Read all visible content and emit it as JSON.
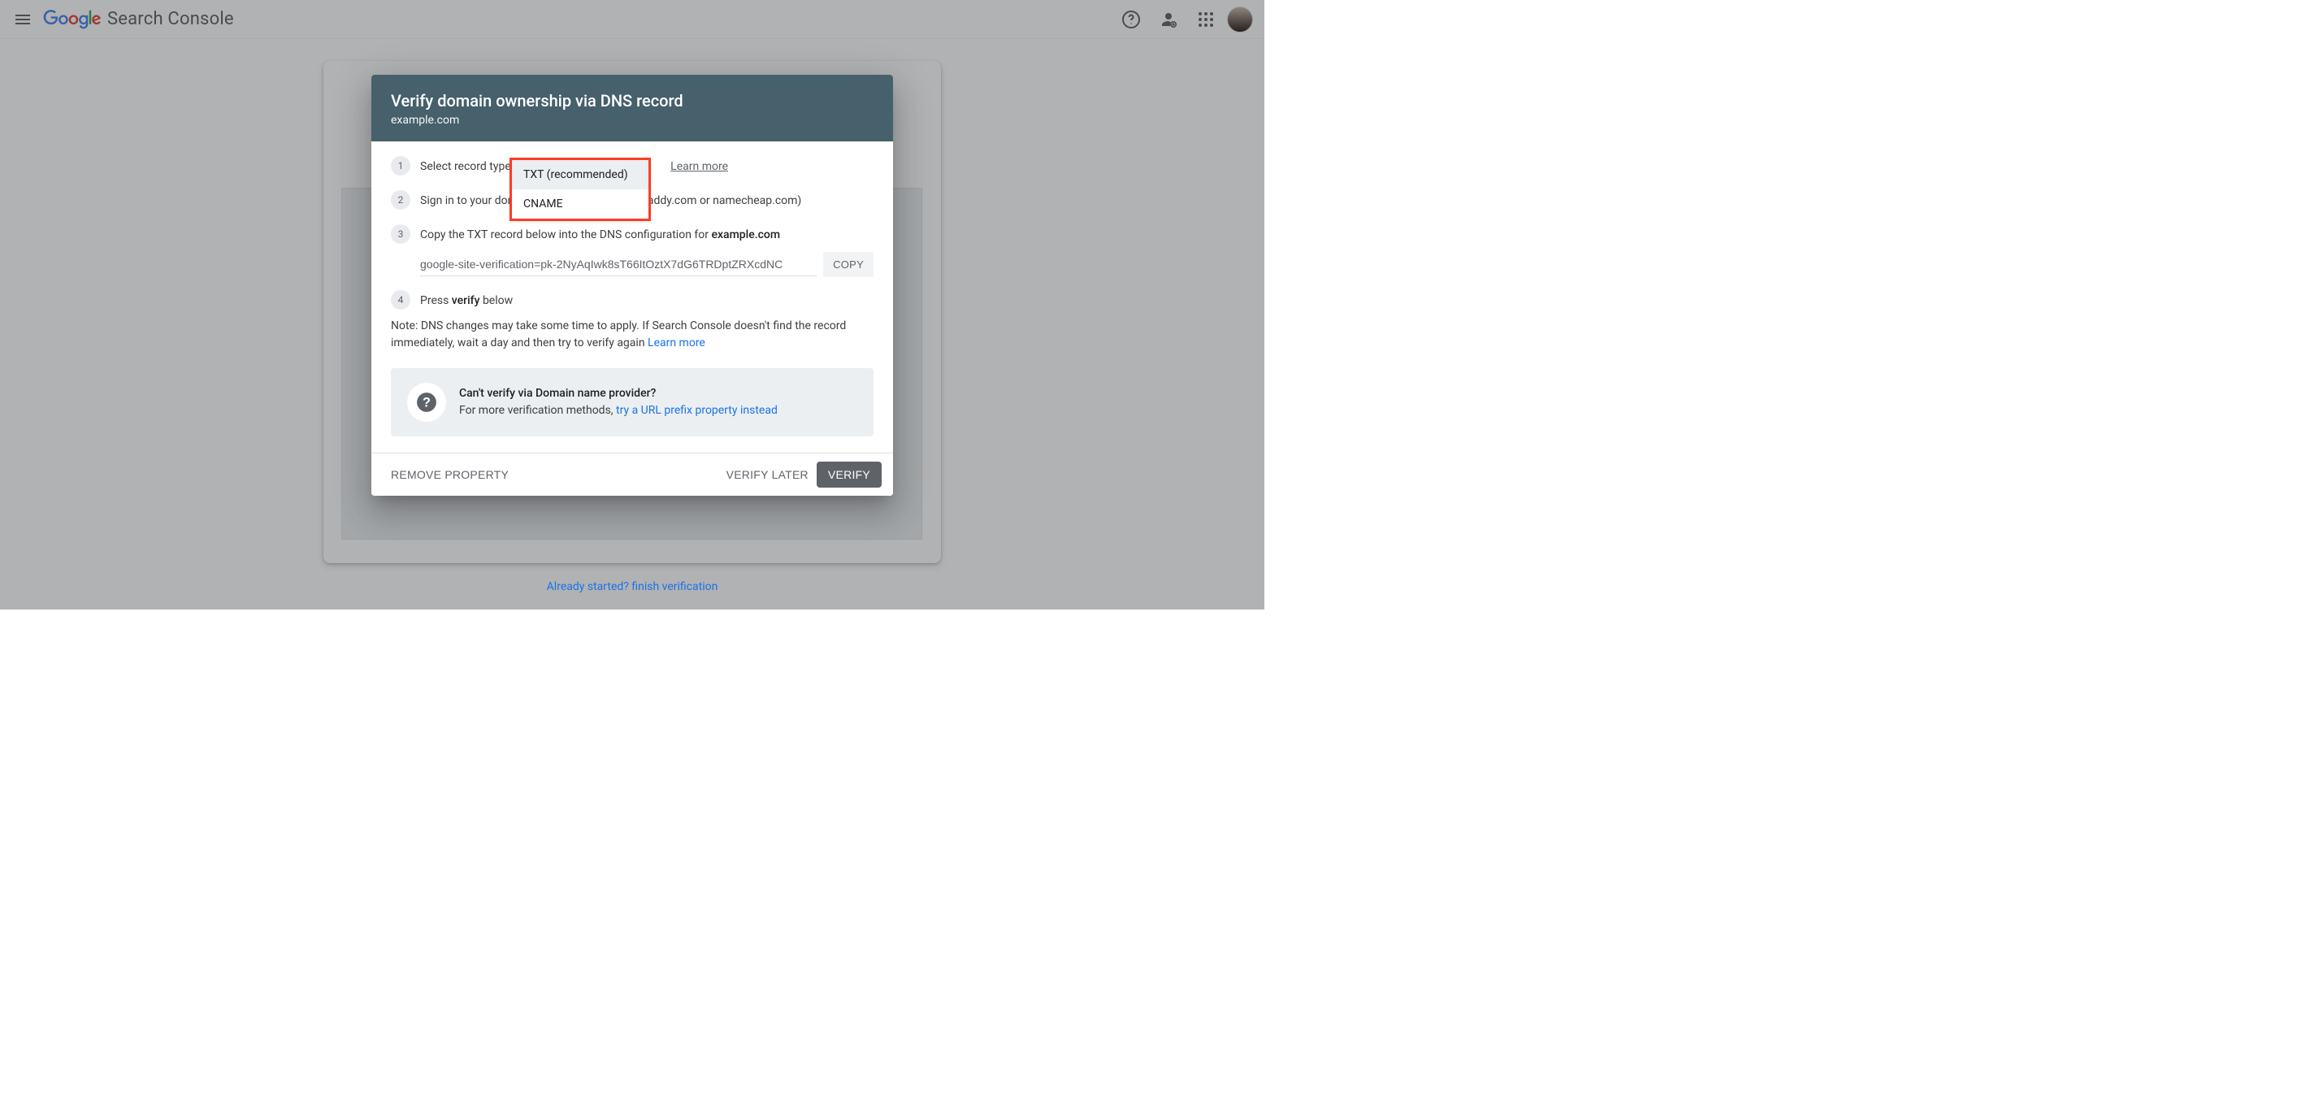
{
  "header": {
    "product": "Search Console"
  },
  "modal": {
    "title": "Verify domain ownership via DNS record",
    "domain": "example.com",
    "steps": {
      "s1": {
        "num": "1",
        "label": "Select record type:",
        "learn_more": "Learn more"
      },
      "s2": {
        "num": "2",
        "text_prefix": "Sign in to your dom",
        "text_suffix": "addy.com or namecheap.com)"
      },
      "s3": {
        "num": "3",
        "text_prefix": "Copy the TXT record below into the DNS configuration for ",
        "domain": "example.com"
      },
      "s4": {
        "num": "4",
        "text_prefix": "Press ",
        "verify_word": "verify",
        "text_suffix": " below"
      }
    },
    "dropdown": {
      "options": [
        {
          "label": "TXT (recommended)",
          "selected": true
        },
        {
          "label": "CNAME",
          "selected": false
        }
      ]
    },
    "txt_value": "google-site-verification=pk-2NyAqIwk8sT66ItOztX7dG6TRDptZRXcdNC",
    "copy_label": "COPY",
    "note_text": "Note: DNS changes may take some time to apply. If Search Console doesn't find the record immediately, wait a day and then try to verify again ",
    "note_link": "Learn more",
    "callout": {
      "title": "Can't verify via Domain name provider?",
      "line2_prefix": "For more verification methods, ",
      "link": "try a URL prefix property instead"
    },
    "actions": {
      "remove": "REMOVE PROPERTY",
      "later": "VERIFY LATER",
      "verify": "VERIFY"
    }
  },
  "footer": {
    "text": "Already started? finish verification"
  }
}
